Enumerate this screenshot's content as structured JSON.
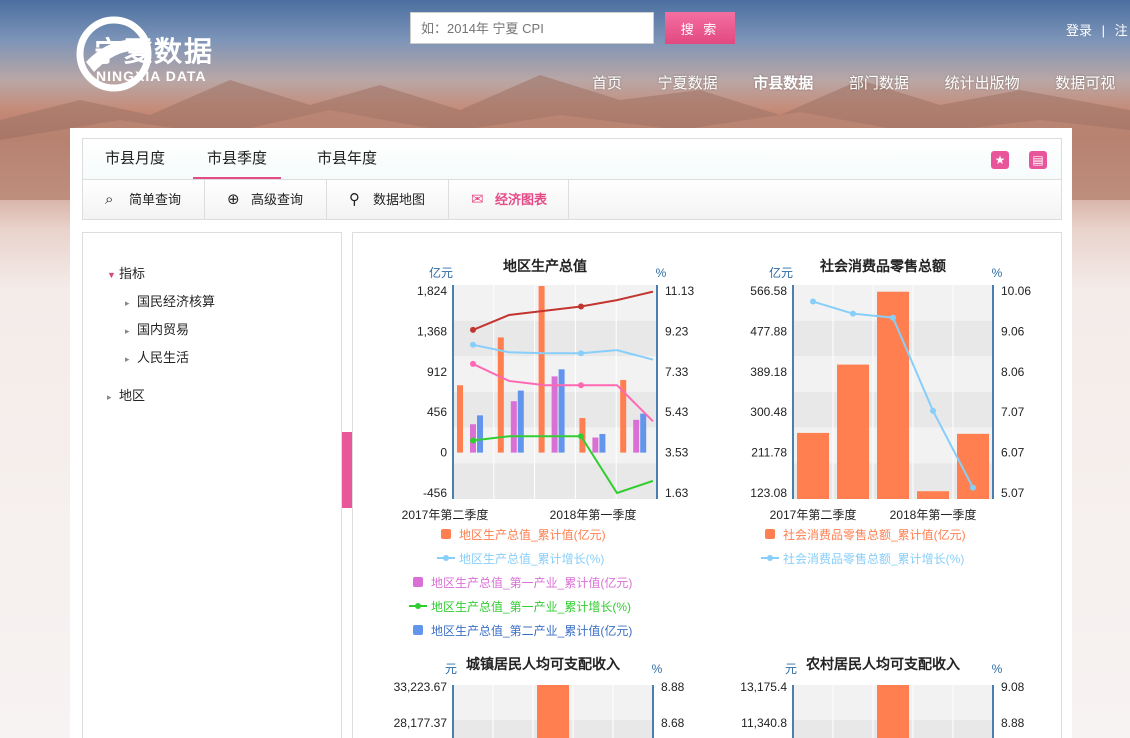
{
  "header": {
    "logo_cn": "宁夏数据",
    "logo_en": "NINGXIA DATA",
    "search_placeholder": "如：2014年 宁夏 CPI",
    "search_button": "搜 索",
    "login": "登录",
    "separator": "|",
    "register": "注",
    "nav": [
      "首页",
      "宁夏数据",
      "市县数据",
      "部门数据",
      "统计出版物",
      "数据可视"
    ]
  },
  "tabs": {
    "items": [
      "市县月度",
      "市县季度",
      "市县年度"
    ],
    "active": "市县季度",
    "favorite_icon": "star-icon",
    "print_icon": "printer-icon"
  },
  "toolbar": {
    "items": [
      "简单查询",
      "高级查询",
      "数据地图",
      "经济图表"
    ],
    "icons": [
      "search-icon",
      "zoom-in-icon",
      "map-pin-icon",
      "chart-icon"
    ]
  },
  "sidebar": {
    "indicator": "指标",
    "children": [
      "国民经济核算",
      "国内贸易",
      "人民生活"
    ],
    "region": "地区"
  },
  "colors": {
    "orange": "#ff7f50",
    "lightblue": "#87cefa",
    "purple": "#da70d6",
    "green": "#32cd32",
    "blue": "#6495ed",
    "darkred": "#c23531",
    "pink": "#ff69b4",
    "accent": "#e44c88"
  },
  "chart_data": [
    {
      "type": "bar",
      "title": "地区生产总值",
      "left_unit": "亿元",
      "right_unit": "%",
      "left_ticks": [
        "1,824",
        "1,368",
        "912",
        "456",
        "0",
        "-456"
      ],
      "right_ticks": [
        "11.13",
        "9.23",
        "7.33",
        "5.43",
        "3.53",
        "1.63"
      ],
      "ylim": [
        -456,
        1824
      ],
      "y2lim": [
        1.63,
        11.13
      ],
      "x_labels": [
        "2017年第二季度",
        "2018年第一季度"
      ],
      "bar_series": [
        {
          "name": "地区生产总值_累计值(亿元)",
          "color": "#ff7f50",
          "values": [
            760,
            1300,
            1880,
            390,
            820
          ]
        },
        {
          "name": "地区生产总值_第一产业_累计值(亿元)",
          "color": "#da70d6",
          "values": [
            320,
            580,
            860,
            170,
            370
          ]
        },
        {
          "name": "地区生产总值_第二产业_累计值(亿元)",
          "color": "#6495ed",
          "values": [
            420,
            700,
            940,
            210,
            440
          ]
        }
      ],
      "line_series": [
        {
          "name": "地区生产总值_累计增长(%)",
          "color": "#87cefa",
          "values": [
            8.6,
            8.25,
            8.2,
            8.2,
            8.35,
            7.9
          ]
        },
        {
          "name": "地区生产总值_第一产业_累计增长(%)",
          "color": "#32cd32",
          "values": [
            4.1,
            4.3,
            4.3,
            4.3,
            1.63,
            2.2
          ]
        },
        {
          "name": "",
          "color": "#c23531",
          "values": [
            9.3,
            10.0,
            10.2,
            10.4,
            10.7,
            11.1
          ]
        },
        {
          "name": "",
          "color": "#ff69b4",
          "values": [
            7.7,
            6.9,
            6.7,
            6.7,
            6.7,
            5.0
          ]
        }
      ],
      "legend": [
        {
          "name": "地区生产总值_累计值(亿元)",
          "color": "#ff7f50",
          "kind": "bar"
        },
        {
          "name": "地区生产总值_累计增长(%)",
          "color": "#87cefa",
          "kind": "line"
        },
        {
          "name": "地区生产总值_第一产业_累计值(亿元)",
          "color": "#da70d6",
          "kind": "bar"
        },
        {
          "name": "地区生产总值_第一产业_累计增长(%)",
          "color": "#32cd32",
          "kind": "line"
        },
        {
          "name": "地区生产总值_第二产业_累计值(亿元)",
          "color": "#6495ed",
          "kind": "bar"
        }
      ]
    },
    {
      "type": "bar",
      "title": "社会消费品零售总额",
      "left_unit": "亿元",
      "right_unit": "%",
      "left_ticks": [
        "566.58",
        "477.88",
        "389.18",
        "300.48",
        "211.78",
        "123.08"
      ],
      "right_ticks": [
        "10.06",
        "9.06",
        "8.06",
        "7.07",
        "6.07",
        "5.07"
      ],
      "ylim": [
        123.08,
        566.58
      ],
      "y2lim": [
        5.07,
        10.06
      ],
      "x_labels": [
        "2017年第二季度",
        "2018年第一季度"
      ],
      "bar_series": [
        {
          "name": "社会消费品零售总额_累计值(亿元)",
          "color": "#ff7f50",
          "values": [
            255,
            405,
            565,
            127,
            253
          ]
        }
      ],
      "line_series": [
        {
          "name": "社会消费品零售总额_累计增长(%)",
          "color": "#87cefa",
          "values": [
            9.8,
            9.5,
            9.4,
            7.1,
            5.2
          ]
        }
      ],
      "legend": [
        {
          "name": "社会消费品零售总额_累计值(亿元)",
          "color": "#ff7f50",
          "kind": "bar"
        },
        {
          "name": "社会消费品零售总额_累计增长(%)",
          "color": "#87cefa",
          "kind": "line"
        }
      ]
    },
    {
      "type": "bar",
      "title": "城镇居民人均可支配收入",
      "left_unit": "元",
      "right_unit": "%",
      "left_ticks": [
        "33,223.67",
        "28,177.37"
      ],
      "right_ticks": [
        "8.88",
        "8.68"
      ],
      "bar_series": [
        {
          "name": "",
          "color": "#ff7f50",
          "values": [
            33223.67
          ]
        }
      ]
    },
    {
      "type": "bar",
      "title": "农村居民人均可支配收入",
      "left_unit": "元",
      "right_unit": "%",
      "left_ticks": [
        "13,175.4",
        "11,340.8"
      ],
      "right_ticks": [
        "9.08",
        "8.88"
      ],
      "bar_series": [
        {
          "name": "",
          "color": "#ff7f50",
          "values": [
            13175.4
          ]
        }
      ]
    }
  ]
}
